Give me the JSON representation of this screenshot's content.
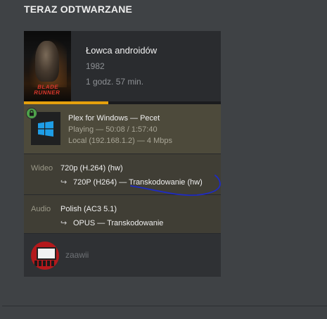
{
  "section": {
    "title": "TERAZ ODTWARZANE"
  },
  "media": {
    "poster_text": "BLADE RUNNER",
    "title": "Łowca androidów",
    "year": "1982",
    "duration": "1 godz. 57 min.",
    "progress_fraction": 0.43
  },
  "player": {
    "name": "Plex for Windows  —  Pecet",
    "state": "Playing — 50:08 / 1:57:40",
    "connection": "Local (192.168.1.2) — 4 Mbps",
    "icon": "windows-icon",
    "secure_icon": "lock-icon"
  },
  "video": {
    "label": "Wideo",
    "source": "720p (H.264) (hw)",
    "transcode": "720P (H264) — Transkodowanie (hw)"
  },
  "audio": {
    "label": "Audio",
    "source": "Polish (AC3 5.1)",
    "transcode": "OPUS — Transkodowanie"
  },
  "user": {
    "name": "zaawii"
  },
  "colors": {
    "accent": "#e5a00d",
    "player_bg": "#4d4a3b",
    "stream_bg": "#403e35",
    "page_bg": "#3f4245",
    "annotation": "#1f2bc0"
  }
}
